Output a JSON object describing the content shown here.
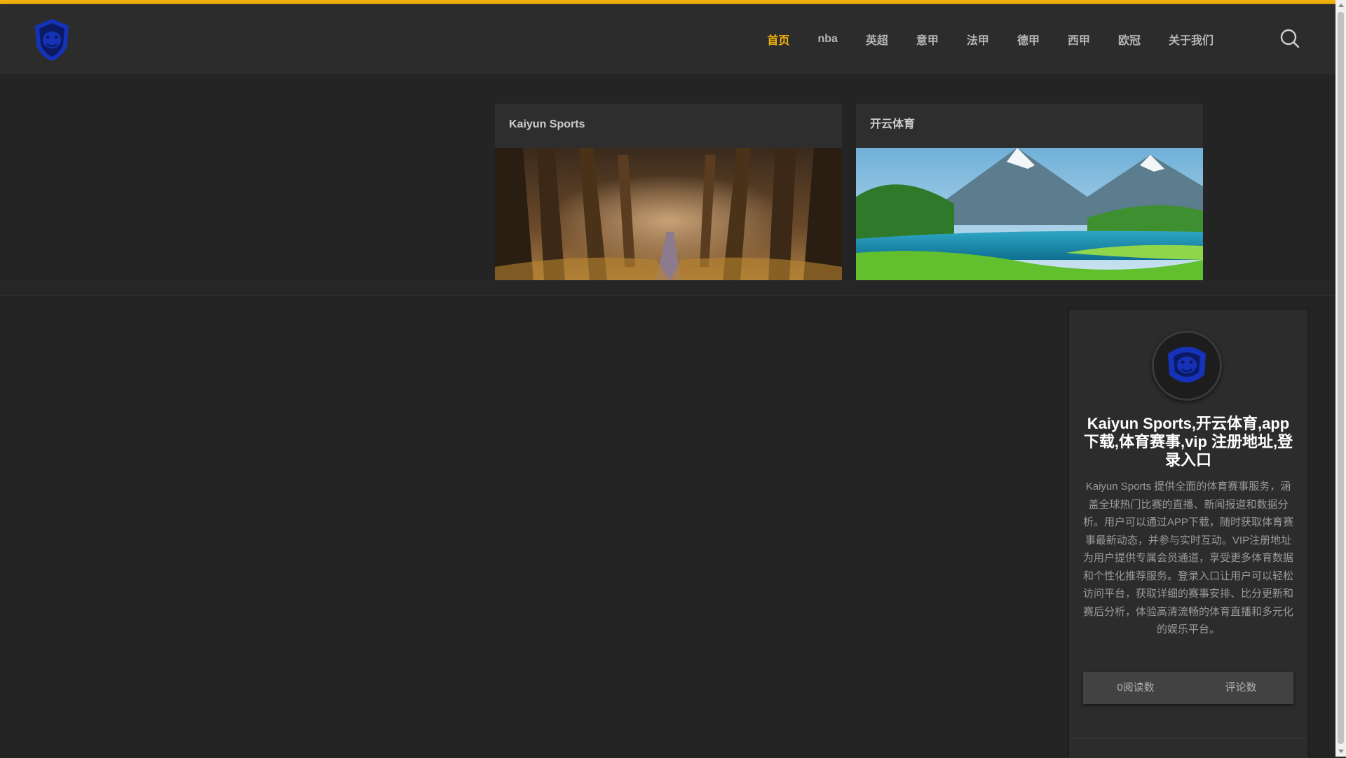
{
  "colors": {
    "accent": "#f1b20e",
    "logo_blue": "#1532b8",
    "background": "#242424"
  },
  "header": {
    "logo_icon": "bulldog-shield-logo",
    "nav": [
      {
        "label": "首页",
        "active": true
      },
      {
        "label": "nba"
      },
      {
        "label": "英超"
      },
      {
        "label": "意甲"
      },
      {
        "label": "法甲"
      },
      {
        "label": "德甲"
      },
      {
        "label": "西甲"
      },
      {
        "label": "欧冠"
      },
      {
        "label": "关于我们"
      }
    ],
    "search_icon": "search-icon"
  },
  "featured": [
    {
      "title": "Kaiyun Sports",
      "image": "forest-path-image"
    },
    {
      "title": "开云体育",
      "image": "mountain-lake-image"
    }
  ],
  "sidebar": {
    "avatar_icon": "bulldog-logo-avatar",
    "title": "Kaiyun Sports,开云体育,app下载,体育赛事,vip 注册地址,登录入口",
    "description": "Kaiyun Sports 提供全面的体育赛事服务，涵盖全球热门比赛的直播、新闻报道和数据分析。用户可以通过APP下载，随时获取体育赛事最新动态，并参与实时互动。VIP注册地址为用户提供专属会员通道，享受更多体育数据和个性化推荐服务。登录入口让用户可以轻松访问平台，获取详细的赛事安排、比分更新和赛后分析，体验高清流畅的体育直播和多元化的娱乐平台。",
    "stats": {
      "reads": "0阅读数",
      "comments": "评论数"
    }
  }
}
